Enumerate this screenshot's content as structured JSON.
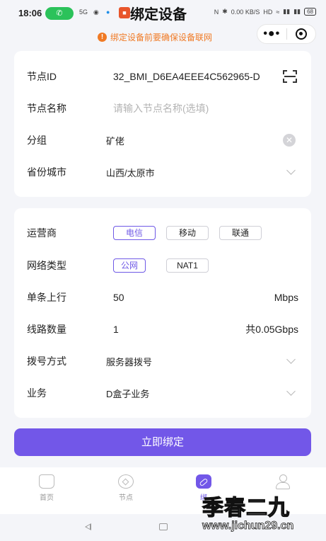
{
  "status_bar": {
    "time": "18:06",
    "net_speed": "0.00 KB/S",
    "battery": "68"
  },
  "header": {
    "title": "绑定设备"
  },
  "notice": {
    "text": "绑定设备前要确保设备联网"
  },
  "form": {
    "node_id": {
      "label": "节点ID",
      "value": "32_BMI_D6EA4EEE4C562965-D"
    },
    "node_name": {
      "label": "节点名称",
      "placeholder": "请输入节点名称(选填)"
    },
    "group": {
      "label": "分组",
      "value": "矿佬"
    },
    "city": {
      "label": "省份城市",
      "value": "山西/太原市"
    },
    "carrier": {
      "label": "运营商",
      "options": [
        "电信",
        "移动",
        "联通"
      ],
      "selected": "电信"
    },
    "network_type": {
      "label": "网络类型",
      "options": [
        "公网",
        "NAT1"
      ],
      "selected": "公网"
    },
    "upload": {
      "label": "单条上行",
      "value": "50",
      "unit": "Mbps"
    },
    "line_count": {
      "label": "线路数量",
      "value": "1",
      "total": "共0.05Gbps"
    },
    "dial_mode": {
      "label": "拨号方式",
      "value": "服务器拨号"
    },
    "business": {
      "label": "业务",
      "value": "D盒子业务"
    }
  },
  "submit_label": "立即绑定",
  "tabs": [
    {
      "label": "首页",
      "icon": "home-icon"
    },
    {
      "label": "节点",
      "icon": "node-icon"
    },
    {
      "label": "绑",
      "icon": "bind-icon"
    },
    {
      "label": "",
      "icon": "user-icon"
    }
  ],
  "watermark": {
    "title": "季春二九",
    "url": "www.jichun29.cn"
  },
  "colors": {
    "accent": "#7257e8",
    "warning": "#f07a25",
    "background": "#f4f5f9"
  }
}
